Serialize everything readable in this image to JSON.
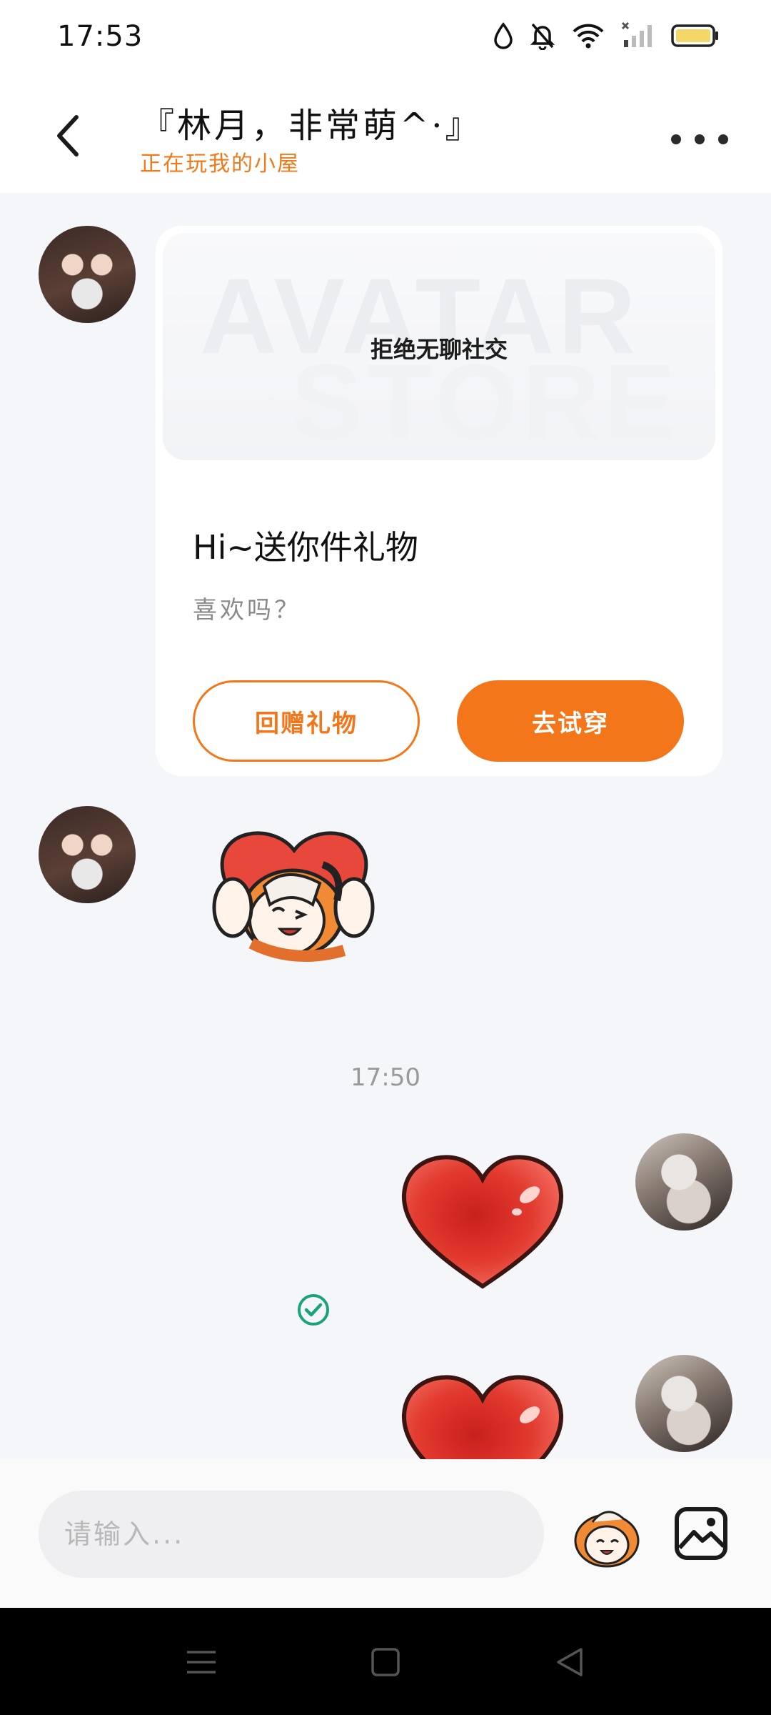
{
  "status_bar": {
    "time": "17:53",
    "icons": [
      "water-drop-icon",
      "bell-off-icon",
      "wifi-icon",
      "signal-icon",
      "battery-icon"
    ]
  },
  "header": {
    "title": "『林月，非常萌^·』",
    "subtitle": "正在玩我的小屋",
    "back_icon": "chevron-left-icon",
    "more_icon": "more-horizontal-icon"
  },
  "chat": {
    "gift_card": {
      "banner_label": "拒绝无聊社交",
      "banner_bg_line1": "AVATAR",
      "banner_bg_line2": "STORE",
      "title": "Hi~送你件礼物",
      "desc": "喜欢吗？",
      "return_gift_button": "回赠礼物",
      "try_on_button": "去试穿"
    },
    "timestamp": "17:50"
  },
  "input_bar": {
    "placeholder": "请输入...",
    "emoji_icon": "sticker-face-icon",
    "image_icon": "image-icon"
  },
  "colors": {
    "accent": "#f3761a",
    "read_check": "#1aa37a",
    "heart": "#e23a2e"
  }
}
